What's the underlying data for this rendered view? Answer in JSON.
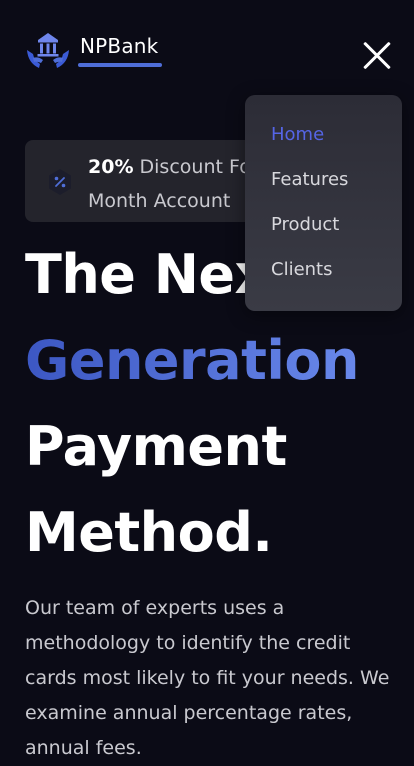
{
  "navbar": {
    "brand": "NPBank",
    "logo_icon": "bank-hands-icon",
    "close_icon": "close-icon",
    "accent_color": "#4f6ed8"
  },
  "menu": {
    "items": [
      {
        "label": "Home",
        "active": true
      },
      {
        "label": "Features",
        "active": false
      },
      {
        "label": "Product",
        "active": false
      },
      {
        "label": "Clients",
        "active": false
      }
    ],
    "active_color": "#5565e6"
  },
  "badge": {
    "icon": "percent-icon",
    "highlight": "20%",
    "text": " Discount For 1 Month Account"
  },
  "hero": {
    "title_line1": "The Next",
    "title_accent": "Generation",
    "title_line3": "Payment",
    "title_line4": "Method.",
    "description": "Our team of experts uses a methodology to identify the credit cards most likely to fit your needs. We examine annual percentage rates, annual fees."
  }
}
